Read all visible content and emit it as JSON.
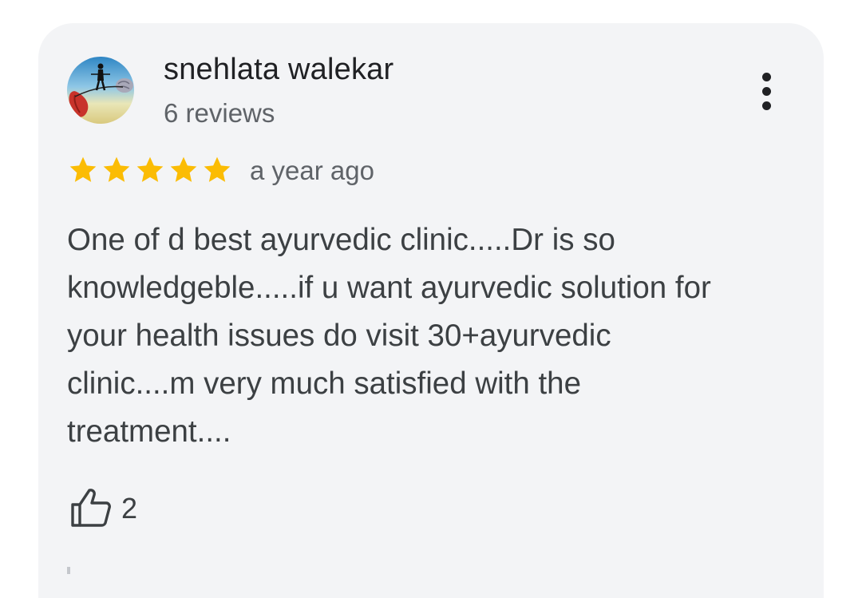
{
  "review": {
    "author": "snehlata walekar",
    "reviews_count": "6 reviews",
    "rating": 5,
    "max_rating": 5,
    "date": "a year ago",
    "text": "One of d best ayurvedic clinic.....Dr is so\nknowledgeble.....if u want ayurvedic solution for\nyour health issues do visit 30+ayurvedic\nclinic....m very much satisfied with the\ntreatment....",
    "likes": "2"
  },
  "colors": {
    "card_background": "#f3f4f6",
    "star": "#fbbc04",
    "primary_text": "#202124",
    "secondary_text": "#5f6368"
  },
  "icons": {
    "avatar": "avatar-image",
    "more": "more-vert-icon",
    "star": "star-icon",
    "like": "thumb-up-icon"
  }
}
